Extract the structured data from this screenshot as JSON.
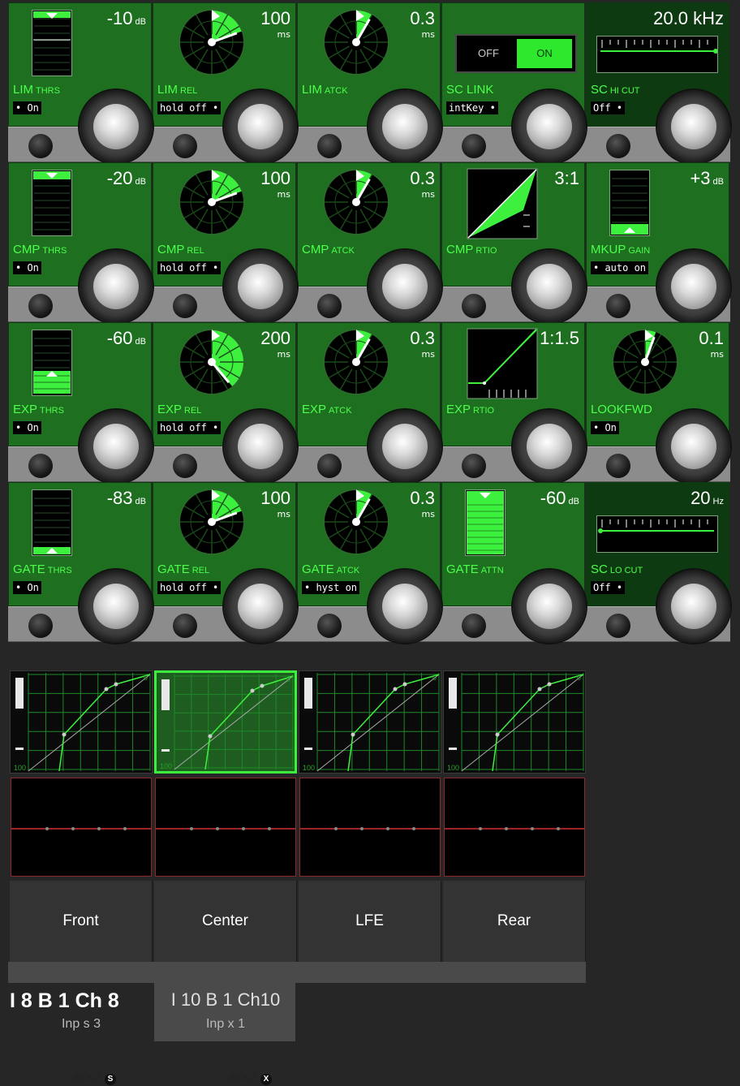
{
  "rows": [
    {
      "cells": [
        {
          "label_main": "LIM",
          "label_sub": "THRS",
          "value": "-10",
          "unit": "dB",
          "status": "• On"
        },
        {
          "label_main": "LIM",
          "label_sub": "REL",
          "value": "100",
          "unit": "ms",
          "status": "hold off  •"
        },
        {
          "label_main": "LIM",
          "label_sub": "ATCK",
          "value": "0.3",
          "unit": "ms",
          "status": ""
        },
        {
          "label_main": "SC LINK",
          "label_sub": "",
          "value": "",
          "unit": "",
          "status": "intKey  •",
          "toggle_off": "OFF",
          "toggle_on": "ON"
        },
        {
          "label_main": "SC",
          "label_sub": "HI CUT",
          "value": "20.0 kHz",
          "unit": "",
          "status": "Off  •"
        }
      ]
    },
    {
      "cells": [
        {
          "label_main": "CMP",
          "label_sub": "THRS",
          "value": "-20",
          "unit": "dB",
          "status": "• On"
        },
        {
          "label_main": "CMP",
          "label_sub": "REL",
          "value": "100",
          "unit": "ms",
          "status": "hold off  •"
        },
        {
          "label_main": "CMP",
          "label_sub": "ATCK",
          "value": "0.3",
          "unit": "ms",
          "status": ""
        },
        {
          "label_main": "CMP",
          "label_sub": "RTIO",
          "value": "3:1",
          "unit": "",
          "status": ""
        },
        {
          "label_main": "MKUP",
          "label_sub": "GAIN",
          "value": "+3",
          "unit": "dB",
          "status": "• auto on"
        }
      ]
    },
    {
      "cells": [
        {
          "label_main": "EXP",
          "label_sub": "THRS",
          "value": "-60",
          "unit": "dB",
          "status": "• On"
        },
        {
          "label_main": "EXP",
          "label_sub": "REL",
          "value": "200",
          "unit": "ms",
          "status": "hold off  •"
        },
        {
          "label_main": "EXP",
          "label_sub": "ATCK",
          "value": "0.3",
          "unit": "ms",
          "status": ""
        },
        {
          "label_main": "EXP",
          "label_sub": "RTIO",
          "value": "1:1.5",
          "unit": "",
          "status": ""
        },
        {
          "label_main": "LOOKFWD",
          "label_sub": "",
          "value": "0.1",
          "unit": "ms",
          "status": "• On"
        }
      ]
    },
    {
      "cells": [
        {
          "label_main": "GATE",
          "label_sub": "THRS",
          "value": "-83",
          "unit": "dB",
          "status": "• On"
        },
        {
          "label_main": "GATE",
          "label_sub": "REL",
          "value": "100",
          "unit": "ms",
          "status": "hold off  •"
        },
        {
          "label_main": "GATE",
          "label_sub": "ATCK",
          "value": "0.3",
          "unit": "ms",
          "status": "• hyst on"
        },
        {
          "label_main": "GATE",
          "label_sub": "ATTN",
          "value": "-60",
          "unit": "dB",
          "status": ""
        },
        {
          "label_main": "SC",
          "label_sub": "LO CUT",
          "value": "20",
          "unit": "Hz",
          "status": "Off  •"
        }
      ]
    }
  ],
  "graph_tick_label": "100",
  "graph_top_label": "0",
  "groups": [
    {
      "name": "Front",
      "selected": false
    },
    {
      "name": "Center",
      "selected": true
    },
    {
      "name": "LFE",
      "selected": false
    },
    {
      "name": "Rear",
      "selected": false
    }
  ],
  "channels": [
    {
      "title": "I 8 B 1 Ch 8",
      "sub": "Inp s  3",
      "tag": "INPUT",
      "tag_letter": "S"
    },
    {
      "title": "I 10 B 1 Ch10",
      "sub": "Inp x  1",
      "tag": "INPUT",
      "tag_letter": "X"
    }
  ],
  "colors": {
    "panel_green": "#1e7020",
    "accent_green": "#3ef03e",
    "eq_line": "#d03030"
  }
}
